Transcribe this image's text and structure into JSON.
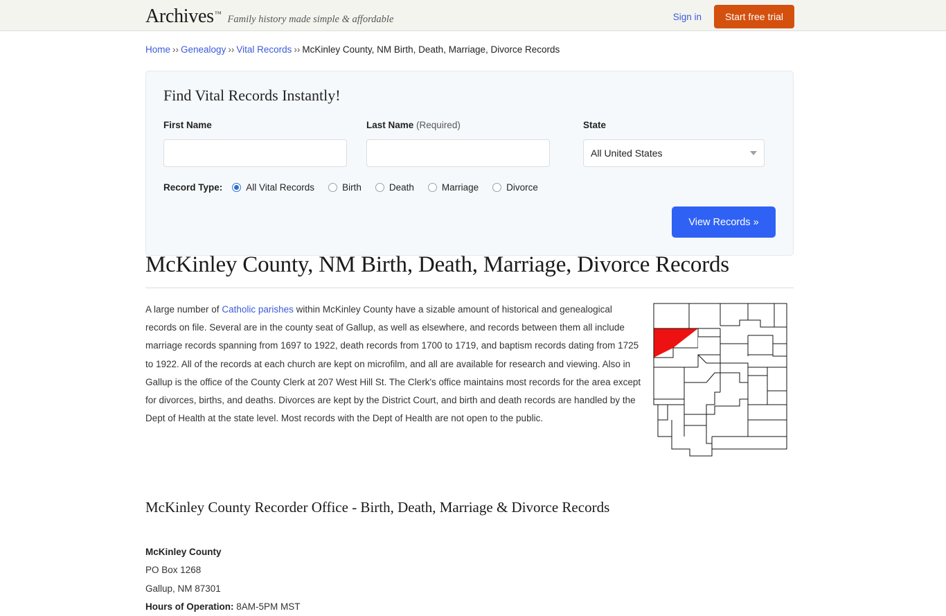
{
  "header": {
    "logo_text": "Archives",
    "logo_tm": "™",
    "tagline": "Family history made simple & affordable",
    "sign_in_label": "Sign in",
    "trial_button_label": "Start free trial",
    "trial_button_color": "#d4500f"
  },
  "breadcrumb": {
    "separator": "››",
    "items": [
      {
        "label": "Home",
        "is_link": true
      },
      {
        "label": "Genealogy",
        "is_link": true
      },
      {
        "label": "Vital Records",
        "is_link": true
      },
      {
        "label": "McKinley County, NM Birth, Death, Marriage, Divorce Records",
        "is_link": false
      }
    ]
  },
  "search_panel": {
    "title": "Find Vital Records Instantly!",
    "first_name": {
      "label": "First Name",
      "value": "",
      "placeholder": ""
    },
    "last_name": {
      "label": "Last Name",
      "required_note": "(Required)",
      "value": "",
      "placeholder": ""
    },
    "state": {
      "label": "State",
      "selected": "All United States",
      "caret_icon": "chevron-down-icon"
    },
    "record_type": {
      "label": "Record Type:",
      "options": [
        {
          "label": "All Vital Records",
          "checked": true
        },
        {
          "label": "Birth",
          "checked": false
        },
        {
          "label": "Death",
          "checked": false
        },
        {
          "label": "Marriage",
          "checked": false
        },
        {
          "label": "Divorce",
          "checked": false
        }
      ],
      "accent_color": "#2f6fd0"
    },
    "submit_label": "View Records »",
    "submit_color": "#2f62f4"
  },
  "main": {
    "page_title": "McKinley County, NM Birth, Death, Marriage, Divorce Records",
    "paragraph": {
      "before_link": "A large number of ",
      "link_text": "Catholic parishes",
      "after_link": " within McKinley County have a sizable amount of historical and genealogical records on file. Several are in the county seat of Gallup, as well as elsewhere, and records between them all include marriage records spanning from 1697 to 1922, death records from 1700 to 1719, and baptism records dating from 1725 to 1922. All of the records at each church are kept on microfilm, and all are available for research and viewing. Also in Gallup is the office of the County Clerk at 207 West Hill St. The Clerk's office maintains most records for the area except for divorces, births, and deaths. Divorces are kept by the District Court, and birth and death records are handled by the Dept of Health at the state level. Most records with the Dept of Health are not open to the public."
    },
    "map": {
      "name": "new-mexico-county-map",
      "highlighted_county": "McKinley",
      "highlight_color": "#ee1111"
    },
    "section_subtitle": "McKinley County Recorder Office - Birth, Death, Marriage & Divorce Records",
    "address": {
      "name": "McKinley County",
      "line1": "PO Box 1268",
      "line2": "Gallup, NM 87301",
      "hours_label": "Hours of Operation:",
      "hours_value": " 8AM-5PM MST"
    }
  }
}
